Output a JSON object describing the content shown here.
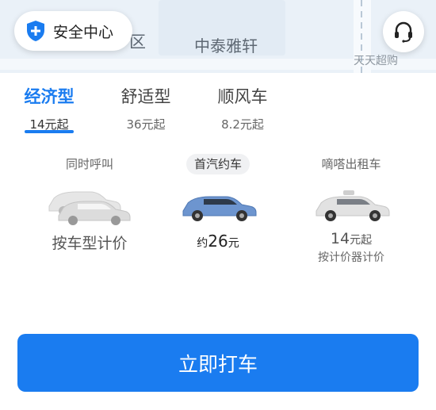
{
  "map": {
    "district_label": "区",
    "poi_label": "中泰雅轩",
    "corner_label": "天天超购"
  },
  "safety": {
    "label": "安全中心",
    "icon": "shield-plus-icon"
  },
  "service": {
    "icon": "headset-icon"
  },
  "tabs": [
    {
      "label": "经济型",
      "price": "14元起",
      "active": true
    },
    {
      "label": "舒适型",
      "price": "36元起",
      "active": false
    },
    {
      "label": "顺风车",
      "price": "8.2元起",
      "active": false
    }
  ],
  "options": [
    {
      "title": "同时呼叫",
      "main": "按车型计价"
    },
    {
      "title": "首汽约车",
      "price_prefix": "约",
      "price_value": "26",
      "price_unit": "元",
      "selected": true
    },
    {
      "title": "嘀嗒出租车",
      "price_value": "14",
      "price_unit": "元起",
      "sub": "按计价器计价"
    }
  ],
  "cta": {
    "label": "立即打车"
  },
  "colors": {
    "accent": "#1a7cf0",
    "selected_car": "#6d95cf",
    "neutral_car": "#d8d8d8"
  }
}
